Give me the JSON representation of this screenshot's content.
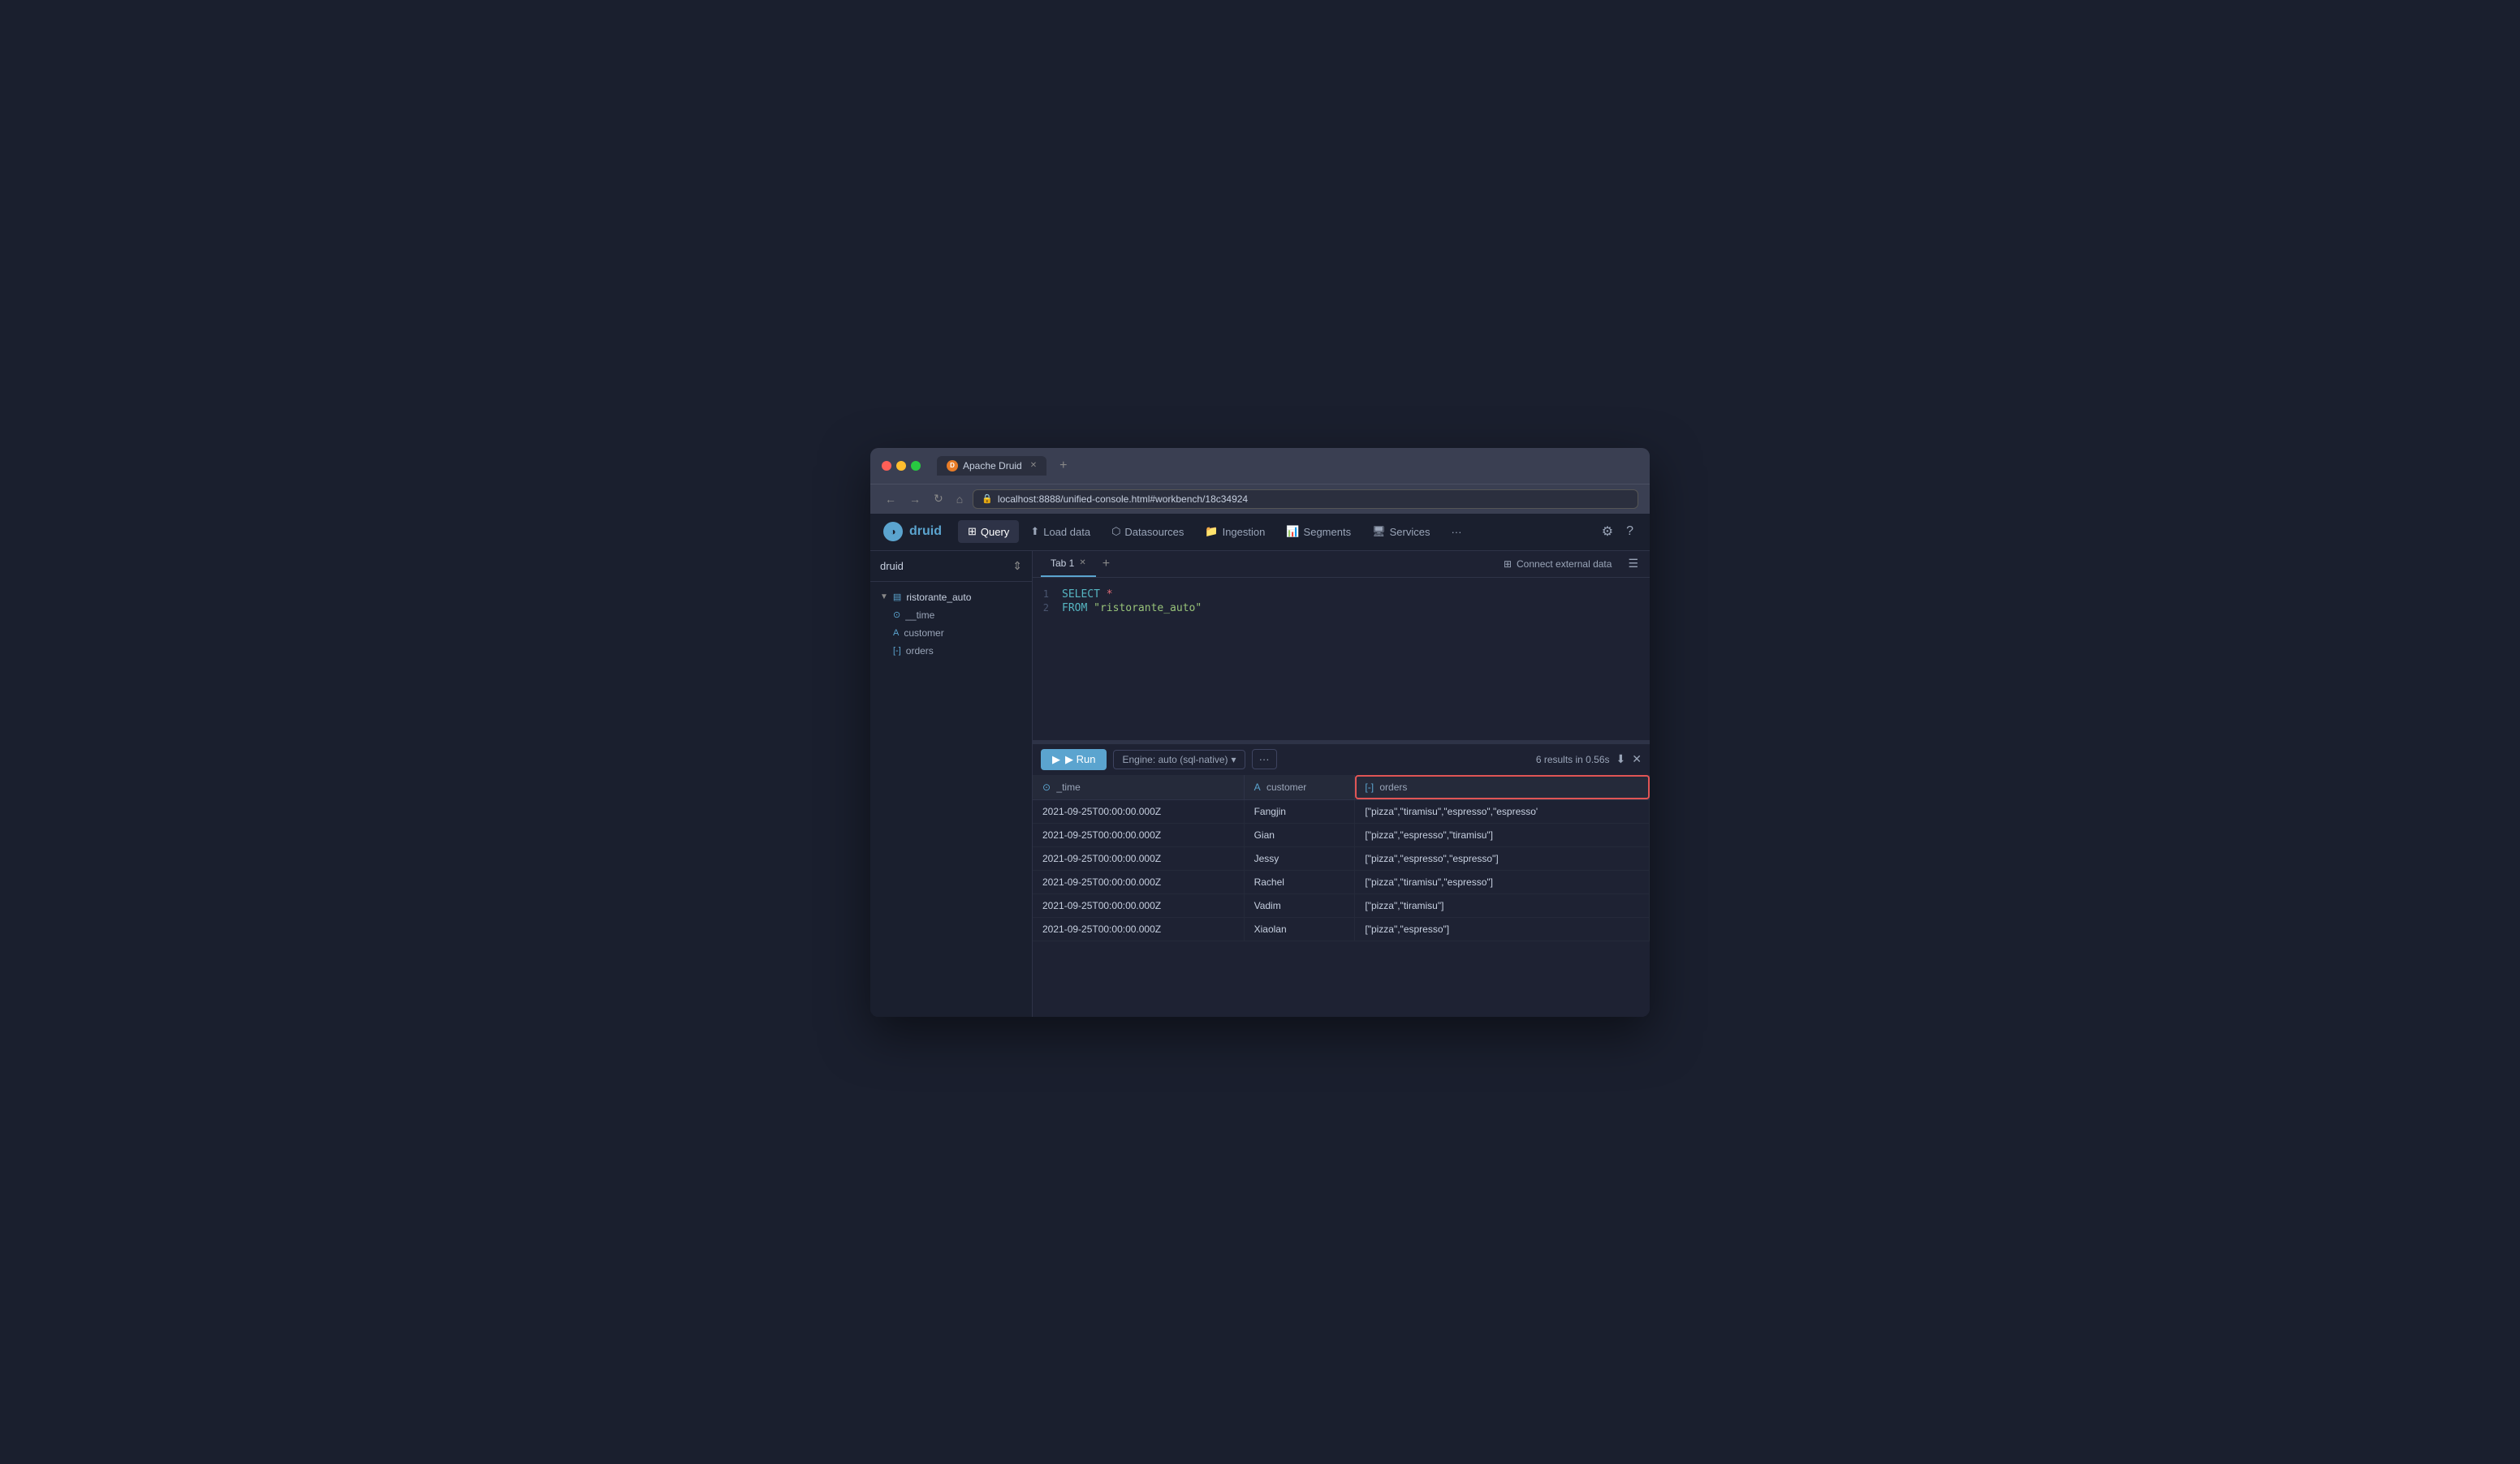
{
  "browser": {
    "traffic_lights": [
      "red",
      "yellow",
      "green"
    ],
    "tab_title": "Apache Druid",
    "url": "localhost:8888/unified-console.html#workbench/18c34924",
    "new_tab_label": "+",
    "nav_back": "←",
    "nav_forward": "→",
    "nav_refresh": "↻",
    "nav_home": "⌂"
  },
  "app": {
    "logo": "druid",
    "logo_icon": "◑",
    "nav_items": [
      {
        "id": "query",
        "label": "Query",
        "icon": "⊞",
        "active": true
      },
      {
        "id": "load-data",
        "label": "Load data",
        "icon": "⬆",
        "active": false
      },
      {
        "id": "datasources",
        "label": "Datasources",
        "icon": "⬡",
        "active": false
      },
      {
        "id": "ingestion",
        "label": "Ingestion",
        "icon": "📁",
        "active": false
      },
      {
        "id": "segments",
        "label": "Segments",
        "icon": "📊",
        "active": false
      },
      {
        "id": "services",
        "label": "Services",
        "icon": "🖧",
        "active": false
      },
      {
        "id": "more",
        "label": "···",
        "icon": "",
        "active": false
      }
    ],
    "gear_icon": "⚙",
    "help_icon": "?"
  },
  "sidebar": {
    "title": "druid",
    "tree": [
      {
        "id": "ristorante-auto",
        "label": "ristorante_auto",
        "type": "table",
        "icon": "▤",
        "expanded": true,
        "level": 0
      },
      {
        "id": "time-col",
        "label": "__time",
        "type": "time",
        "icon": "⊙",
        "level": 1
      },
      {
        "id": "customer-col",
        "label": "customer",
        "type": "string",
        "icon": "A",
        "level": 1
      },
      {
        "id": "orders-col",
        "label": "orders",
        "type": "array",
        "icon": "[-]",
        "level": 1
      }
    ]
  },
  "editor": {
    "tab_label": "Tab 1",
    "connect_external_label": "Connect external data",
    "lines": [
      {
        "num": "1",
        "content": "SELECT *"
      },
      {
        "num": "2",
        "content": "FROM \"ristorante_auto\""
      }
    ],
    "sql_keywords": {
      "select": "SELECT",
      "from": "FROM",
      "star": "*",
      "table": "\"ristorante_auto\""
    }
  },
  "toolbar": {
    "run_label": "▶ Run",
    "engine_label": "Engine: auto (sql-native)",
    "engine_dropdown": "▾",
    "more_label": "···",
    "results_count": "6 results in 0.56s"
  },
  "results": {
    "columns": [
      {
        "id": "time",
        "icon": "⊙",
        "label": "_time",
        "highlighted": false
      },
      {
        "id": "customer",
        "icon": "A",
        "label": "customer",
        "highlighted": false
      },
      {
        "id": "orders",
        "icon": "[-]",
        "label": "orders",
        "highlighted": true
      }
    ],
    "rows": [
      {
        "time": "2021-09-25T00:00:00.000Z",
        "customer": "Fangjin",
        "orders": "[\"pizza\",\"tiramisu\",\"espresso\",\"espresso'"
      },
      {
        "time": "2021-09-25T00:00:00.000Z",
        "customer": "Gian",
        "orders": "[\"pizza\",\"espresso\",\"tiramisu\"]"
      },
      {
        "time": "2021-09-25T00:00:00.000Z",
        "customer": "Jessy",
        "orders": "[\"pizza\",\"espresso\",\"espresso\"]"
      },
      {
        "time": "2021-09-25T00:00:00.000Z",
        "customer": "Rachel",
        "orders": "[\"pizza\",\"tiramisu\",\"espresso\"]"
      },
      {
        "time": "2021-09-25T00:00:00.000Z",
        "customer": "Vadim",
        "orders": "[\"pizza\",\"tiramisu\"]"
      },
      {
        "time": "2021-09-25T00:00:00.000Z",
        "customer": "Xiaolan",
        "orders": "[\"pizza\",\"espresso\"]"
      }
    ]
  }
}
